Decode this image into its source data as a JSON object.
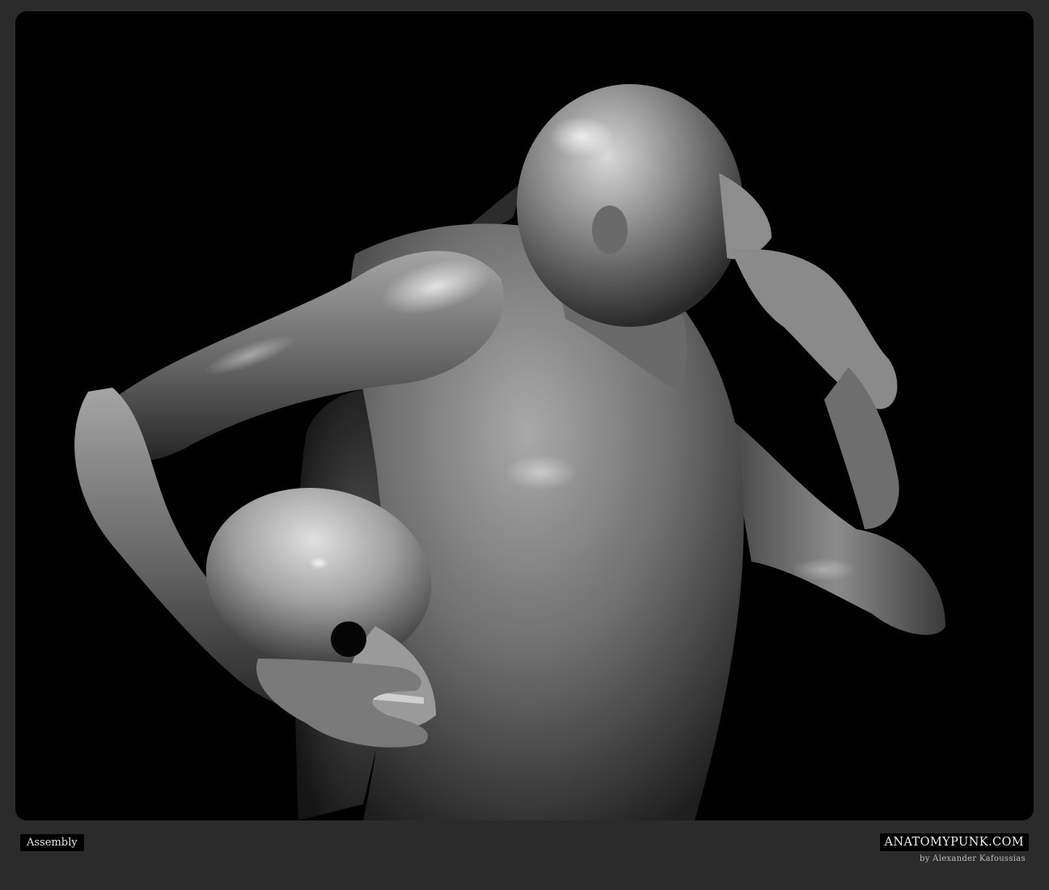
{
  "image": {
    "subject_icon": "anatomy-sculpture-render"
  },
  "footer": {
    "caption": "Assembly",
    "brand": "ANATOMYPUNK.COM",
    "credit": "by Alexander Kafoussias"
  },
  "colors": {
    "background": "#2b2b2b",
    "viewport": "#000000",
    "skin_light": "#b8b8b8",
    "skin_dark": "#3a3a3a"
  }
}
